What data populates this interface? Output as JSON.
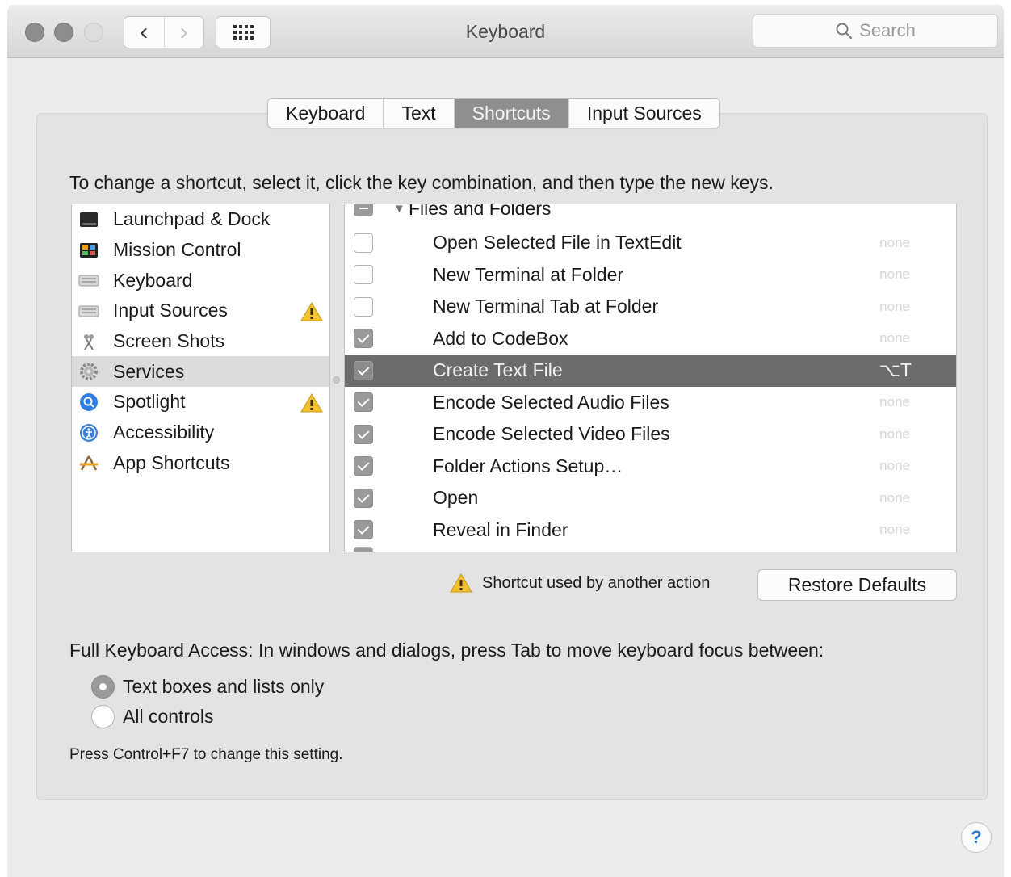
{
  "window": {
    "title": "Keyboard",
    "search_placeholder": "Search",
    "nav_back": "‹",
    "nav_forward": "›"
  },
  "tabs": [
    {
      "label": "Keyboard",
      "active": false
    },
    {
      "label": "Text",
      "active": false
    },
    {
      "label": "Shortcuts",
      "active": true
    },
    {
      "label": "Input Sources",
      "active": false
    }
  ],
  "instruction": "To change a shortcut, select it, click the key combination, and then type the new keys.",
  "categories": [
    {
      "label": "Launchpad & Dock",
      "icon": "launchpad-dock-icon",
      "warning": false,
      "selected": false
    },
    {
      "label": "Mission Control",
      "icon": "mission-control-icon",
      "warning": false,
      "selected": false
    },
    {
      "label": "Keyboard",
      "icon": "keyboard-icon",
      "warning": false,
      "selected": false
    },
    {
      "label": "Input Sources",
      "icon": "input-sources-icon",
      "warning": true,
      "selected": false
    },
    {
      "label": "Screen Shots",
      "icon": "screen-shots-icon",
      "warning": false,
      "selected": false
    },
    {
      "label": "Services",
      "icon": "services-gear-icon",
      "warning": false,
      "selected": true
    },
    {
      "label": "Spotlight",
      "icon": "spotlight-icon",
      "warning": true,
      "selected": false
    },
    {
      "label": "Accessibility",
      "icon": "accessibility-icon",
      "warning": false,
      "selected": false
    },
    {
      "label": "App Shortcuts",
      "icon": "app-shortcuts-icon",
      "warning": false,
      "selected": false
    }
  ],
  "services": {
    "group_label": "Files and Folders",
    "rows": [
      {
        "label": "Open Selected File in TextEdit",
        "checked": false,
        "shortcut": "none",
        "selected": false
      },
      {
        "label": "New Terminal at Folder",
        "checked": false,
        "shortcut": "none",
        "selected": false
      },
      {
        "label": "New Terminal Tab at Folder",
        "checked": false,
        "shortcut": "none",
        "selected": false
      },
      {
        "label": "Add to CodeBox",
        "checked": true,
        "shortcut": "none",
        "selected": false
      },
      {
        "label": "Create Text File",
        "checked": true,
        "shortcut": "⌥T",
        "selected": true
      },
      {
        "label": "Encode Selected Audio Files",
        "checked": true,
        "shortcut": "none",
        "selected": false
      },
      {
        "label": "Encode Selected Video Files",
        "checked": true,
        "shortcut": "none",
        "selected": false
      },
      {
        "label": "Folder Actions Setup…",
        "checked": true,
        "shortcut": "none",
        "selected": false
      },
      {
        "label": "Open",
        "checked": true,
        "shortcut": "none",
        "selected": false
      },
      {
        "label": "Reveal in Finder",
        "checked": true,
        "shortcut": "none",
        "selected": false
      }
    ]
  },
  "conflict_text": "Shortcut used by another action",
  "restore_label": "Restore Defaults",
  "full_keyboard_access": {
    "label": "Full Keyboard Access: In windows and dialogs, press Tab to move keyboard focus between:",
    "options": [
      {
        "label": "Text boxes and lists only",
        "selected": true
      },
      {
        "label": "All controls",
        "selected": false
      }
    ],
    "hint": "Press Control+F7 to change this setting."
  },
  "help_label": "?",
  "colors": {
    "selection_dark": "#6c6c6c",
    "active_tab": "#8f8f8f",
    "warning_yellow": "#f2c230",
    "help_blue": "#2a7bd6"
  }
}
